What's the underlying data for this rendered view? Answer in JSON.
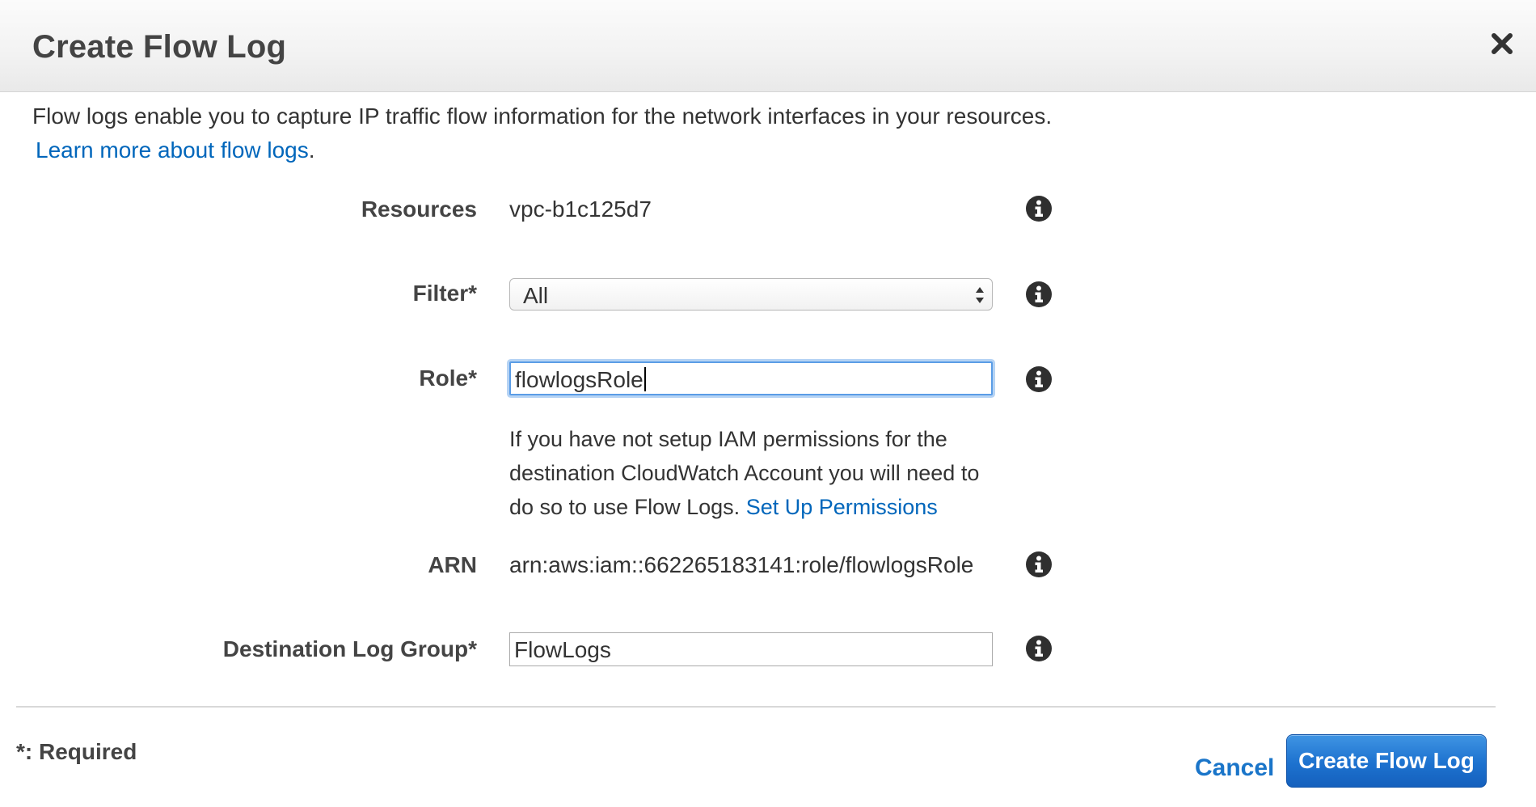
{
  "dialog": {
    "title": "Create Flow Log",
    "close_icon": "close-icon"
  },
  "intro": {
    "text": "Flow logs enable you to capture IP traffic flow information for the network interfaces in your resources.",
    "learn_more_link": "Learn more about flow logs",
    "learn_more_suffix": "."
  },
  "form": {
    "resources": {
      "label": "Resources",
      "value": "vpc-b1c125d7"
    },
    "filter": {
      "label": "Filter*",
      "selected": "All"
    },
    "role": {
      "label": "Role*",
      "value": "flowlogsRole",
      "help_text": "If you have not setup IAM permissions for the destination CloudWatch Account you will need to do so to use Flow Logs.",
      "help_link": "Set Up Permissions"
    },
    "arn": {
      "label": "ARN",
      "value": "arn:aws:iam::662265183141:role/flowlogsRole"
    },
    "destination_log_group": {
      "label": "Destination Log Group*",
      "value": "FlowLogs"
    },
    "info_icon": "info-icon"
  },
  "footer": {
    "required_note": "*: Required",
    "cancel_label": "Cancel",
    "create_label": "Create Flow Log"
  },
  "colors": {
    "link": "#0066bb",
    "primary_button": "#1d72cf",
    "focus_ring": "#5b9de6"
  }
}
